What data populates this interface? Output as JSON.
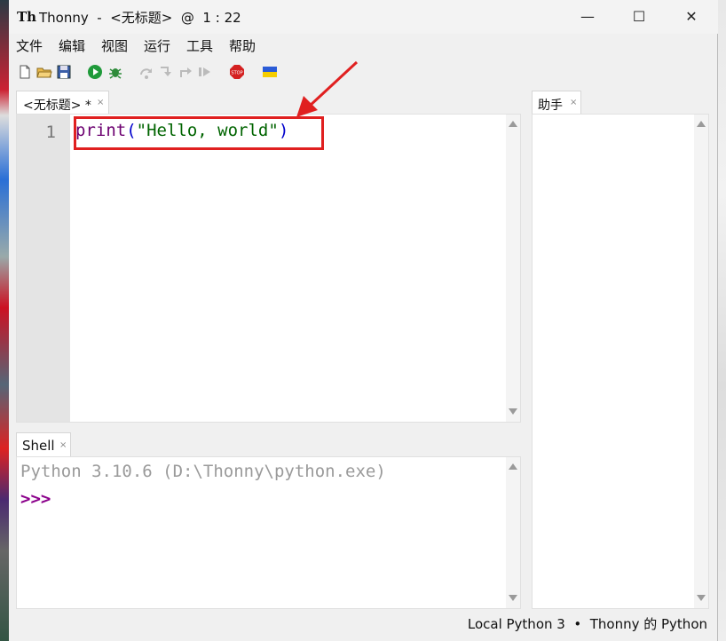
{
  "window": {
    "title": "Thonny  -  <无标题>  @  1 : 22",
    "logo_text": "Th",
    "controls": {
      "minimize": "—",
      "maximize": "☐",
      "close": "✕"
    }
  },
  "menu": [
    "文件",
    "编辑",
    "视图",
    "运行",
    "工具",
    "帮助"
  ],
  "toolbar": [
    "new-file-icon",
    "open-file-icon",
    "save-icon",
    "run-icon",
    "debug-icon",
    "step-over-icon",
    "step-into-icon",
    "step-out-icon",
    "resume-icon",
    "stop-icon",
    "ukraine-flag-icon"
  ],
  "colors": {
    "stop": "#d42020",
    "run": "#1f9a3a",
    "flag_blue": "#2a5bd7",
    "flag_yellow": "#f5cd00",
    "annotation": "#e02020"
  },
  "editor": {
    "tab_label": "<无标题> *",
    "tab_close": "×",
    "line_number": "1",
    "code": {
      "fn": "print",
      "open": "(",
      "str": "\"Hello, world\"",
      "close": ")"
    }
  },
  "shell": {
    "tab_label": "Shell",
    "tab_close": "×",
    "banner": "Python 3.10.6 (D:\\Thonny\\python.exe)",
    "prompt": ">>>"
  },
  "assistant": {
    "tab_label": "助手",
    "tab_close": "×"
  },
  "status": {
    "text": "Local Python 3  •  Thonny 的 Python"
  }
}
